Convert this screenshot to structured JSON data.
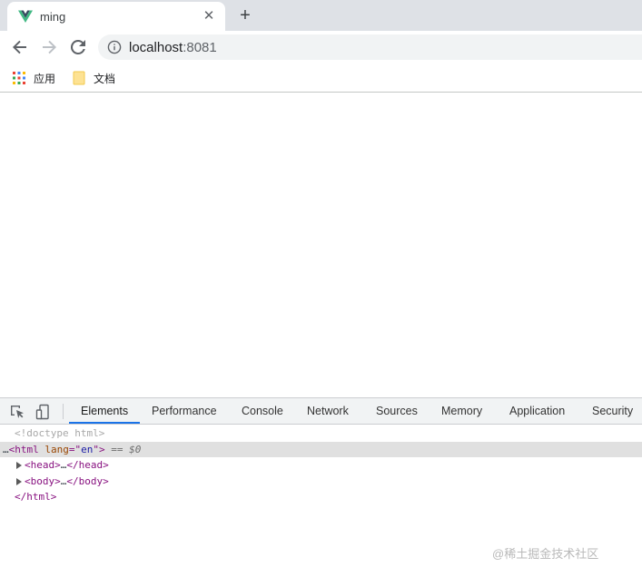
{
  "tab": {
    "title": "ming",
    "close_glyph": "✕",
    "favicon": "vue-logo-icon"
  },
  "new_tab_glyph": "+",
  "toolbar": {
    "url_host": "localhost",
    "url_port": ":8081"
  },
  "bookmarks": [
    {
      "label": "应用",
      "icon": "apps-grid-icon"
    },
    {
      "label": "文档",
      "icon": "folder-icon"
    }
  ],
  "devtools": {
    "tabs": [
      "Elements",
      "Performance",
      "Console",
      "Network",
      "Sources",
      "Memory",
      "Application",
      "Security"
    ],
    "active_tab": "Elements",
    "dom": {
      "doctype": "<!doctype html>",
      "html_open_tag": "<html",
      "html_attr_name": "lang",
      "html_attr_eq": "=\"",
      "html_attr_value": "en",
      "html_attr_close": "\">",
      "selected_hint": "== $0",
      "ellipsis_prefix": "…",
      "head_open": "<head>",
      "head_close": "</head>",
      "body_open": "<body>",
      "body_close": "</body>",
      "inner_ellipsis": "…",
      "html_close": "</html>"
    }
  },
  "watermark": "@稀土掘金技术社区",
  "colors": {
    "active_tab_underline": "#1a73e8",
    "tag": "#881280",
    "attr": "#994500",
    "value": "#1a1aa6"
  }
}
